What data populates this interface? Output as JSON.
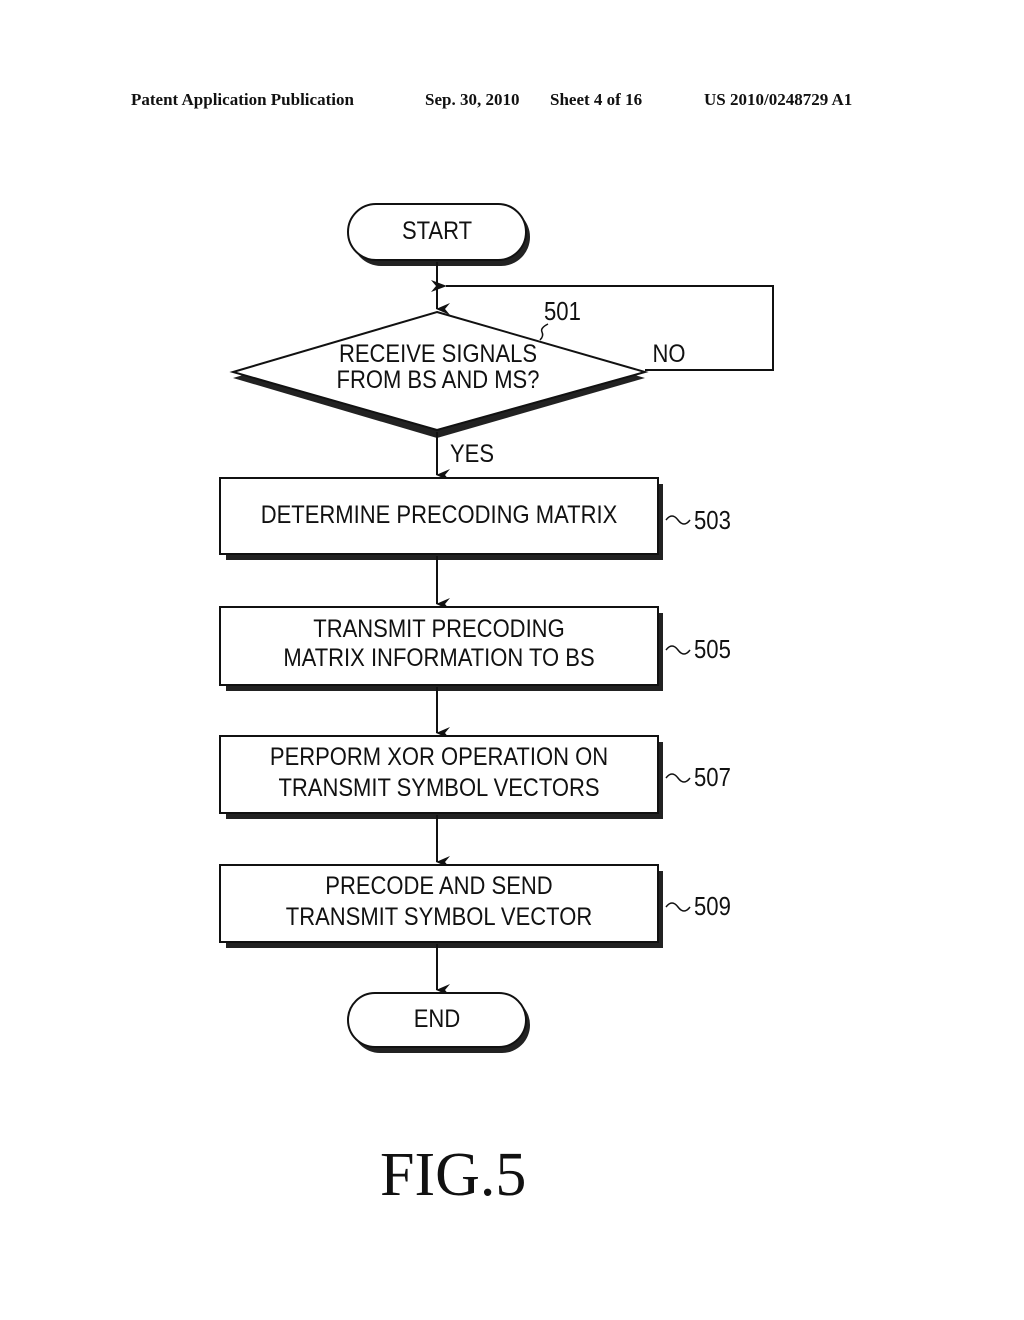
{
  "header": {
    "publication": "Patent Application Publication",
    "date": "Sep. 30, 2010",
    "sheet": "Sheet 4 of 16",
    "number": "US 2010/0248729 A1"
  },
  "flowchart": {
    "start": "START",
    "decision": {
      "ref": "501",
      "line1": "RECEIVE SIGNALS",
      "line2": "FROM BS AND MS?",
      "no_label": "NO",
      "yes_label": "YES"
    },
    "steps": [
      {
        "ref": "503",
        "line1": "DETERMINE PRECODING MATRIX",
        "line2": ""
      },
      {
        "ref": "505",
        "line1": "TRANSMIT PRECODING",
        "line2": "MATRIX INFORMATION TO BS"
      },
      {
        "ref": "507",
        "line1": "PERPORM XOR OPERATION ON",
        "line2": "TRANSMIT SYMBOL VECTORS"
      },
      {
        "ref": "509",
        "line1": "PRECODE AND SEND",
        "line2": "TRANSMIT SYMBOL VECTOR"
      }
    ],
    "end": "END"
  },
  "figure_label": "FIG.5"
}
